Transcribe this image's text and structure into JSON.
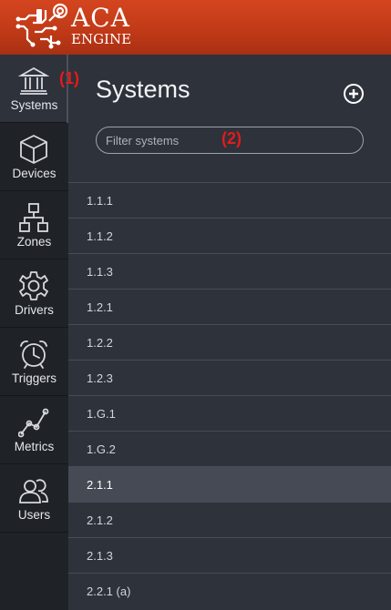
{
  "brand": {
    "line1": "ACA",
    "line2": "ENGINE",
    "header_color": "#c13a17"
  },
  "sidebar": {
    "items": [
      {
        "label": "Systems",
        "icon": "building-columns-icon",
        "active": true
      },
      {
        "label": "Devices",
        "icon": "cube-icon",
        "active": false
      },
      {
        "label": "Zones",
        "icon": "sitemap-icon",
        "active": false
      },
      {
        "label": "Drivers",
        "icon": "gear-icon",
        "active": false
      },
      {
        "label": "Triggers",
        "icon": "alarm-clock-icon",
        "active": false
      },
      {
        "label": "Metrics",
        "icon": "line-graph-icon",
        "active": false
      },
      {
        "label": "Users",
        "icon": "users-icon",
        "active": false
      }
    ]
  },
  "main": {
    "title": "Systems",
    "add_icon": "plus-circle-icon",
    "search": {
      "placeholder": "Filter systems",
      "value": ""
    },
    "systems": [
      "1.1.1",
      "1.1.2",
      "1.1.3",
      "1.2.1",
      "1.2.2",
      "1.2.3",
      "1.G.1",
      "1.G.2",
      "2.1.1",
      "2.1.2",
      "2.1.3",
      "2.2.1 (a)"
    ],
    "selected": "2.1.1"
  },
  "annotations": {
    "one": "(1)",
    "two": "(2)",
    "color": "#e31b1b"
  }
}
